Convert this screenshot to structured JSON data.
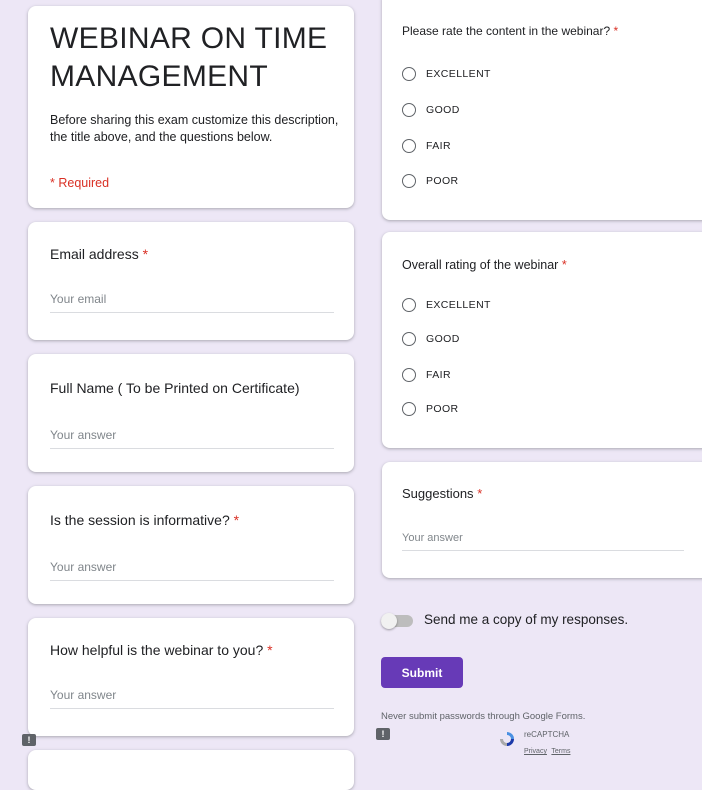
{
  "form": {
    "title": "WEBINAR ON TIME MANAGEMENT",
    "description": "Before sharing this exam customize this description, the title above, and the questions below.",
    "required_note": "* Required"
  },
  "questions": {
    "email": {
      "label": "Email address",
      "required": "*",
      "placeholder": "Your email"
    },
    "full_name": {
      "label": "Full Name ( To be Printed on Certificate)",
      "placeholder": "Your answer"
    },
    "informative": {
      "label": "Is the session is informative?",
      "required": "*",
      "placeholder": "Your answer"
    },
    "helpful": {
      "label": "How helpful is the webinar to you?",
      "required": "*",
      "placeholder": "Your answer"
    },
    "content_rating": {
      "label": "Please rate the content in the webinar?",
      "required": "*",
      "options": [
        "EXCELLENT",
        "GOOD",
        "FAIR",
        "POOR"
      ]
    },
    "overall_rating": {
      "label": "Overall rating of the webinar",
      "required": "*",
      "options": [
        "EXCELLENT",
        "GOOD",
        "FAIR",
        "POOR"
      ]
    },
    "suggestions": {
      "label": "Suggestions",
      "required": "*",
      "placeholder": "Your answer"
    }
  },
  "footer": {
    "send_copy": "Send me a copy of my responses.",
    "submit": "Submit",
    "password_note": "Never submit passwords through Google Forms.",
    "recaptcha": "reCAPTCHA",
    "privacy": "Privacy",
    "terms": "Terms",
    "report_icon_glyph": "!"
  },
  "colors": {
    "background": "#ede7f6",
    "accent": "#673ab7",
    "required": "#d93025"
  },
  "icons": [
    "report-abuse-icon",
    "recaptcha-logo-icon"
  ]
}
